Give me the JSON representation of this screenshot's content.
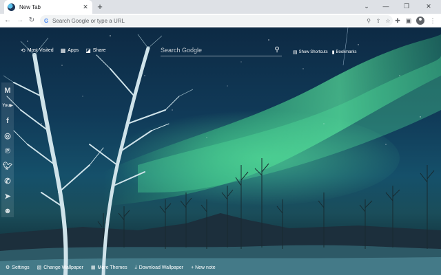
{
  "tab": {
    "title": "New Tab",
    "close_icon": "close-icon"
  },
  "window": {
    "minimize": "⌄",
    "restore": "—",
    "maximize": "❐",
    "close": "✕"
  },
  "address_bar": {
    "placeholder": "Search Google or type a URL"
  },
  "topnav": {
    "most_visited": "Most Visited",
    "apps": "Apps",
    "share": "Share"
  },
  "search": {
    "placeholder": "Search Google"
  },
  "rightnav": {
    "show_shortcuts": "Show Shortcuts",
    "bookmarks": "Bookmarks"
  },
  "social": [
    "gmail",
    "youtube",
    "facebook",
    "instagram",
    "pinterest",
    "twitter",
    "whatsapp",
    "telegram",
    "reddit"
  ],
  "bottombar": {
    "settings": "Settings",
    "change_wallpaper": "Change Wallpaper",
    "more_themes": "More Themes",
    "download_wallpaper": "Download Wallpaper",
    "new_note": "+ New note"
  },
  "colors": {
    "aurora": "#3fd68a",
    "sky": "#0d2a44"
  }
}
